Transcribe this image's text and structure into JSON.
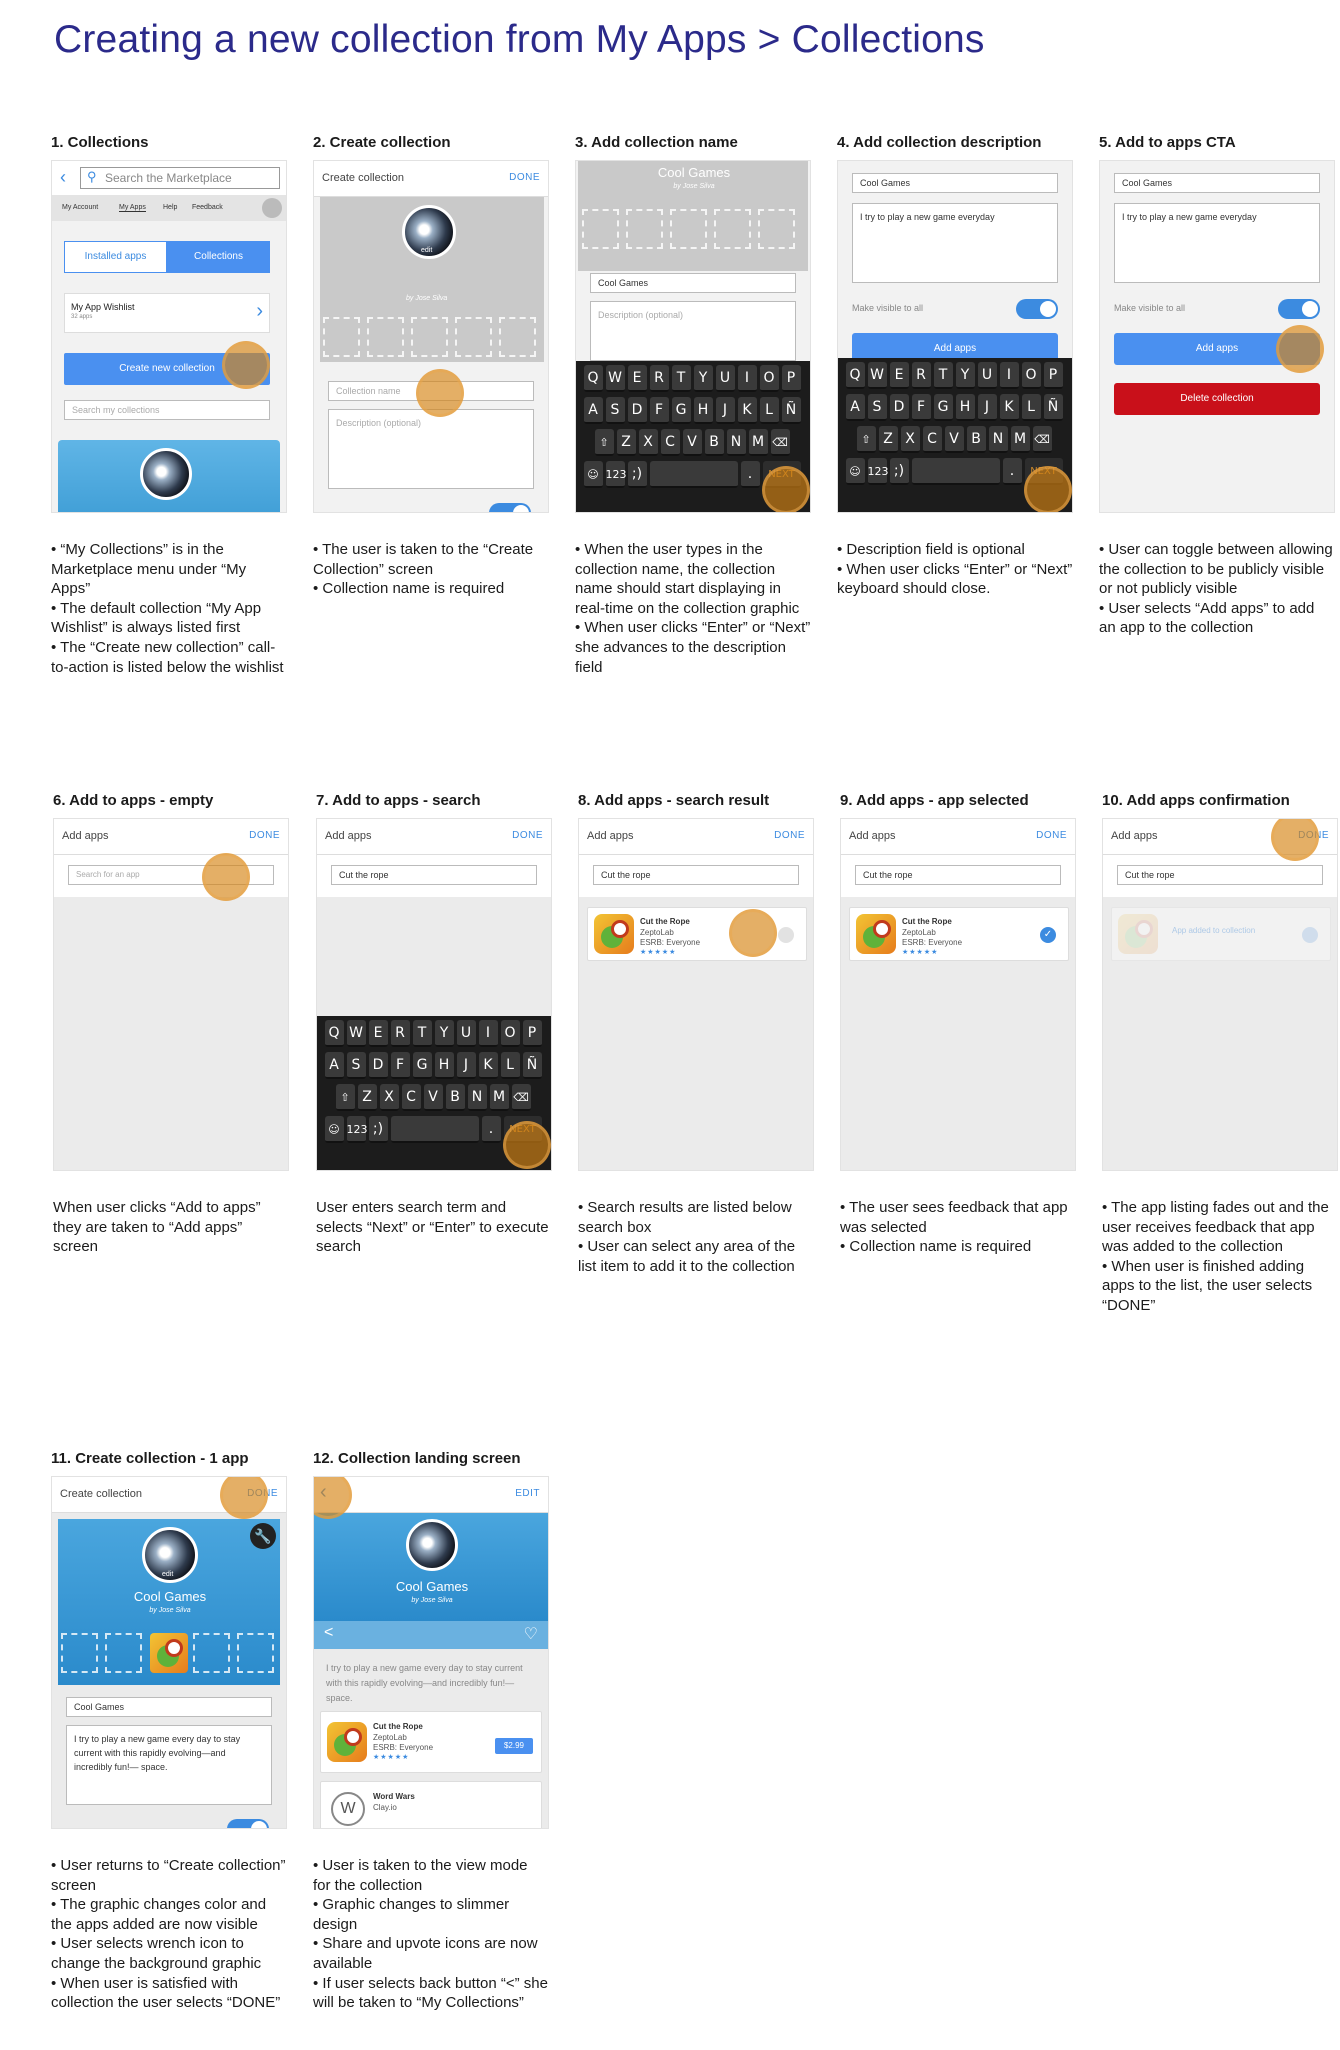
{
  "page_title": "Creating a new collection from My Apps > Collections",
  "keyboard": {
    "row1": [
      "Q",
      "W",
      "E",
      "R",
      "T",
      "Y",
      "U",
      "I",
      "O",
      "P"
    ],
    "row2": [
      "A",
      "S",
      "D",
      "F",
      "G",
      "H",
      "J",
      "K",
      "L",
      "Ñ"
    ],
    "row3": [
      "Z",
      "X",
      "C",
      "V",
      "B",
      "N",
      "M"
    ],
    "num": "123",
    "next": "NEXT"
  },
  "common": {
    "done": "DONE",
    "add_apps_title": "Add apps",
    "create_collection_title": "Create collection",
    "collection_name": "Cool Games",
    "collection_name_placeholder": "Collection name",
    "description_placeholder": "Description (optional)",
    "description_short": "I try to play a new game everyday",
    "description_long": "I try to play a new game every day to stay current with this rapidly evolving—and incredibly fun!— space.",
    "make_visible": "Make visible to all",
    "add_apps_btn": "Add apps",
    "delete_btn": "Delete collection",
    "by_author": "by Jose Silva",
    "edit": "edit",
    "search_term": "Cut the rope",
    "search_placeholder": "Search for an app"
  },
  "app": {
    "name": "Cut the Rope",
    "dev": "ZeptoLab",
    "rating": "ESRB: Everyone",
    "stars": "★★★★★",
    "price": "$2.99"
  },
  "app2": {
    "name": "Word Wars",
    "dev": "Clay.io"
  },
  "steps": [
    {
      "title": "1. Collections",
      "desc": [
        "• “My Collections” is in the Marketplace menu under “My Apps”",
        "• The default collection “My App Wishlist” is always listed first",
        "• The “Create new collection” call-to-action is listed below the wishlist"
      ]
    },
    {
      "title": "2. Create collection",
      "desc": [
        "• The user is taken to the “Create Collection” screen",
        "• Collection name is required"
      ]
    },
    {
      "title": "3. Add collection name",
      "desc": [
        "• When the user types in the collection name, the collection name should start displaying in real-time on the collection graphic",
        "• When user clicks “Enter” or “Next” she advances to the description field"
      ]
    },
    {
      "title": "4. Add collection description",
      "desc": [
        "• Description field is optional",
        "• When user clicks “Enter” or “Next” keyboard should close."
      ]
    },
    {
      "title": "5. Add to apps CTA",
      "desc": [
        "• User can toggle between allowing the collection to be publicly visible or not publicly visible",
        "• User selects “Add apps” to add an app to the collection"
      ]
    },
    {
      "title": "6. Add to apps - empty",
      "desc": [
        "When user clicks “Add to apps” they are taken to “Add apps” screen"
      ]
    },
    {
      "title": "7. Add to apps - search",
      "desc": [
        "User enters search term and selects “Next” or “Enter” to execute search"
      ]
    },
    {
      "title": "8. Add apps - search result",
      "desc": [
        "• Search results are listed below search box",
        "• User can select any area of the list item to add it to the collection"
      ]
    },
    {
      "title": "9. Add apps - app selected",
      "desc": [
        "• The user sees feedback that app was selected",
        "• Collection name is required"
      ]
    },
    {
      "title": "10. Add apps confirmation",
      "desc": [
        "• The app listing fades out and the user receives feedback that app was added to the collection",
        "• When user is finished adding apps to the list, the user selects “DONE”"
      ]
    },
    {
      "title": "11. Create collection - 1 app",
      "desc": [
        "• User returns to “Create collection” screen",
        "• The graphic changes color and the apps added are now visible",
        "• User selects wrench icon to change the background graphic",
        "• When user is satisfied with collection the user selects “DONE”"
      ]
    },
    {
      "title": "12. Collection landing screen",
      "desc": [
        "• User is taken to the view mode for the collection",
        "• Graphic changes to slimmer design",
        "• Share and upvote icons are now available",
        "• If user selects back button “<” she will be taken to “My Collections”"
      ]
    }
  ],
  "screen1": {
    "search_placeholder": "Search the Marketplace",
    "menu": [
      "My Account",
      "My Apps",
      "Help",
      "Feedback"
    ],
    "tab_installed": "Installed apps",
    "tab_collections": "Collections",
    "wishlist_name": "My App Wishlist",
    "wishlist_count": "32 apps",
    "create_btn": "Create new collection",
    "search_collections": "Search my collections"
  },
  "screen10": {
    "added": "App added to collection"
  },
  "screen12": {
    "edit": "EDIT"
  },
  "colors": {
    "accent": "#3c8be0",
    "title": "#2b2a8a",
    "highlight": "#d68414",
    "delete": "#c9101a"
  }
}
